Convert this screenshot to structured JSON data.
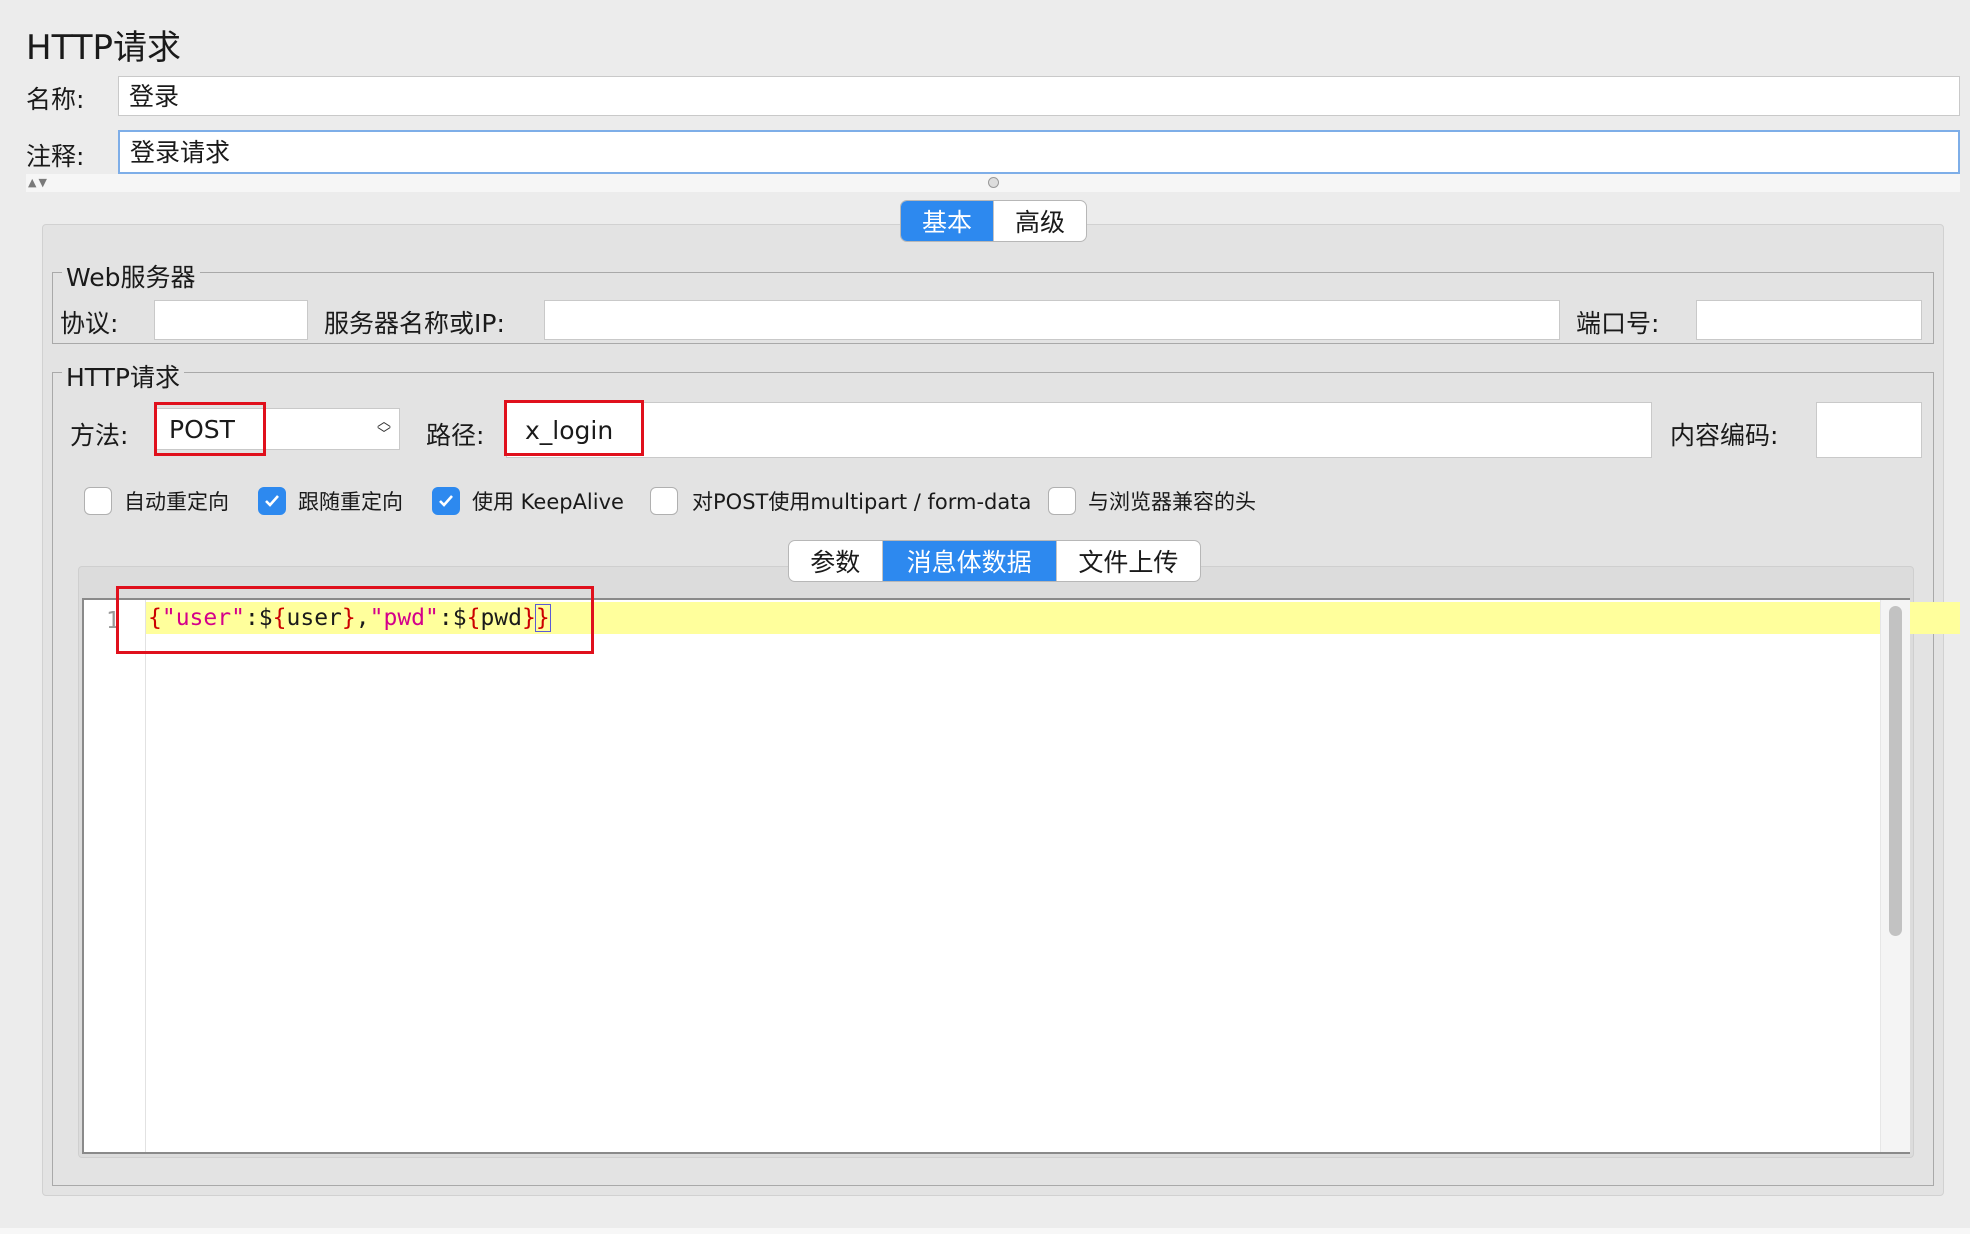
{
  "header": {
    "title": "HTTP请求"
  },
  "name_field": {
    "label": "名称:",
    "value": "登录"
  },
  "comment_field": {
    "label": "注释:",
    "value": "登录请求"
  },
  "main_tabs": [
    {
      "label": "基本",
      "active": true
    },
    {
      "label": "高级",
      "active": false
    }
  ],
  "web_server": {
    "legend": "Web服务器",
    "protocol_label": "协议:",
    "protocol_value": "",
    "server_label": "服务器名称或IP:",
    "server_value": "",
    "port_label": "端口号:",
    "port_value": ""
  },
  "http_request": {
    "legend": "HTTP请求",
    "method_label": "方法:",
    "method_value": "POST",
    "path_label": "路径:",
    "path_value": "x_login",
    "encoding_label": "内容编码:",
    "encoding_value": "",
    "options": [
      {
        "label": "自动重定向",
        "checked": false
      },
      {
        "label": "跟随重定向",
        "checked": true
      },
      {
        "label": "使用 KeepAlive",
        "checked": true
      },
      {
        "label": "对POST使用multipart / form-data",
        "checked": false
      },
      {
        "label": "与浏览器兼容的头",
        "checked": false
      }
    ]
  },
  "body_tabs": [
    {
      "label": "参数",
      "active": false
    },
    {
      "label": "消息体数据",
      "active": true
    },
    {
      "label": "文件上传",
      "active": false
    }
  ],
  "editor": {
    "line_number": "1",
    "tokens": [
      {
        "t": "{",
        "k": "brace"
      },
      {
        "t": "\"user\"",
        "k": "str"
      },
      {
        "t": ":$",
        "k": "var"
      },
      {
        "t": "{",
        "k": "brace"
      },
      {
        "t": "user",
        "k": "var"
      },
      {
        "t": "}",
        "k": "brace"
      },
      {
        "t": ",",
        "k": "var"
      },
      {
        "t": "\"pwd\"",
        "k": "str"
      },
      {
        "t": ":$",
        "k": "var"
      },
      {
        "t": "{",
        "k": "brace"
      },
      {
        "t": "pwd",
        "k": "var"
      },
      {
        "t": "}",
        "k": "brace"
      },
      {
        "t": "}",
        "k": "brace"
      }
    ]
  },
  "colors": {
    "accent": "#2d89ef",
    "highlight": "#e0101c",
    "current_line": "#ffff9c"
  }
}
